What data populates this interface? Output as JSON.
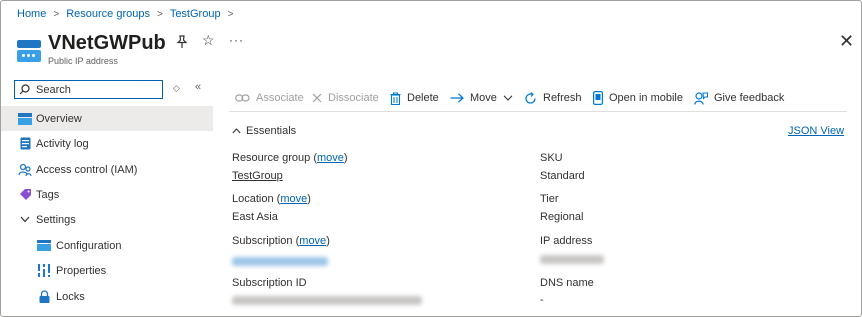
{
  "breadcrumb": {
    "home": "Home",
    "resource_groups": "Resource groups",
    "group": "TestGroup"
  },
  "resource": {
    "name": "VNetGWPub",
    "type": "Public IP address",
    "more_label": "···"
  },
  "sidebar": {
    "search_placeholder": "Search",
    "items": [
      {
        "label": "Overview",
        "icon": "overview-icon",
        "active": true
      },
      {
        "label": "Activity log",
        "icon": "activity-log-icon"
      },
      {
        "label": "Access control (IAM)",
        "icon": "iam-icon"
      },
      {
        "label": "Tags",
        "icon": "tag-icon"
      },
      {
        "label": "Settings",
        "icon": "chevron-down-icon"
      },
      {
        "label": "Configuration",
        "icon": "configuration-icon"
      },
      {
        "label": "Properties",
        "icon": "properties-icon"
      },
      {
        "label": "Locks",
        "icon": "lock-icon"
      }
    ]
  },
  "toolbar": {
    "associate": "Associate",
    "dissociate": "Dissociate",
    "delete": "Delete",
    "move": "Move",
    "refresh": "Refresh",
    "open_mobile": "Open in mobile",
    "feedback": "Give feedback"
  },
  "essentials": {
    "title": "Essentials",
    "json_view": "JSON View",
    "move_link": "move",
    "resource_group_label": "Resource group",
    "resource_group_value": "TestGroup",
    "location_label": "Location",
    "location_value": "East Asia",
    "subscription_label": "Subscription",
    "subscription_id_label": "Subscription ID",
    "sku_label": "SKU",
    "sku_value": "Standard",
    "tier_label": "Tier",
    "tier_value": "Regional",
    "ip_label": "IP address",
    "dns_label": "DNS name",
    "dns_value": "-"
  },
  "colors": {
    "link": "#0064b4",
    "accent": "#0078d4",
    "active_nav": "#edebe9"
  }
}
